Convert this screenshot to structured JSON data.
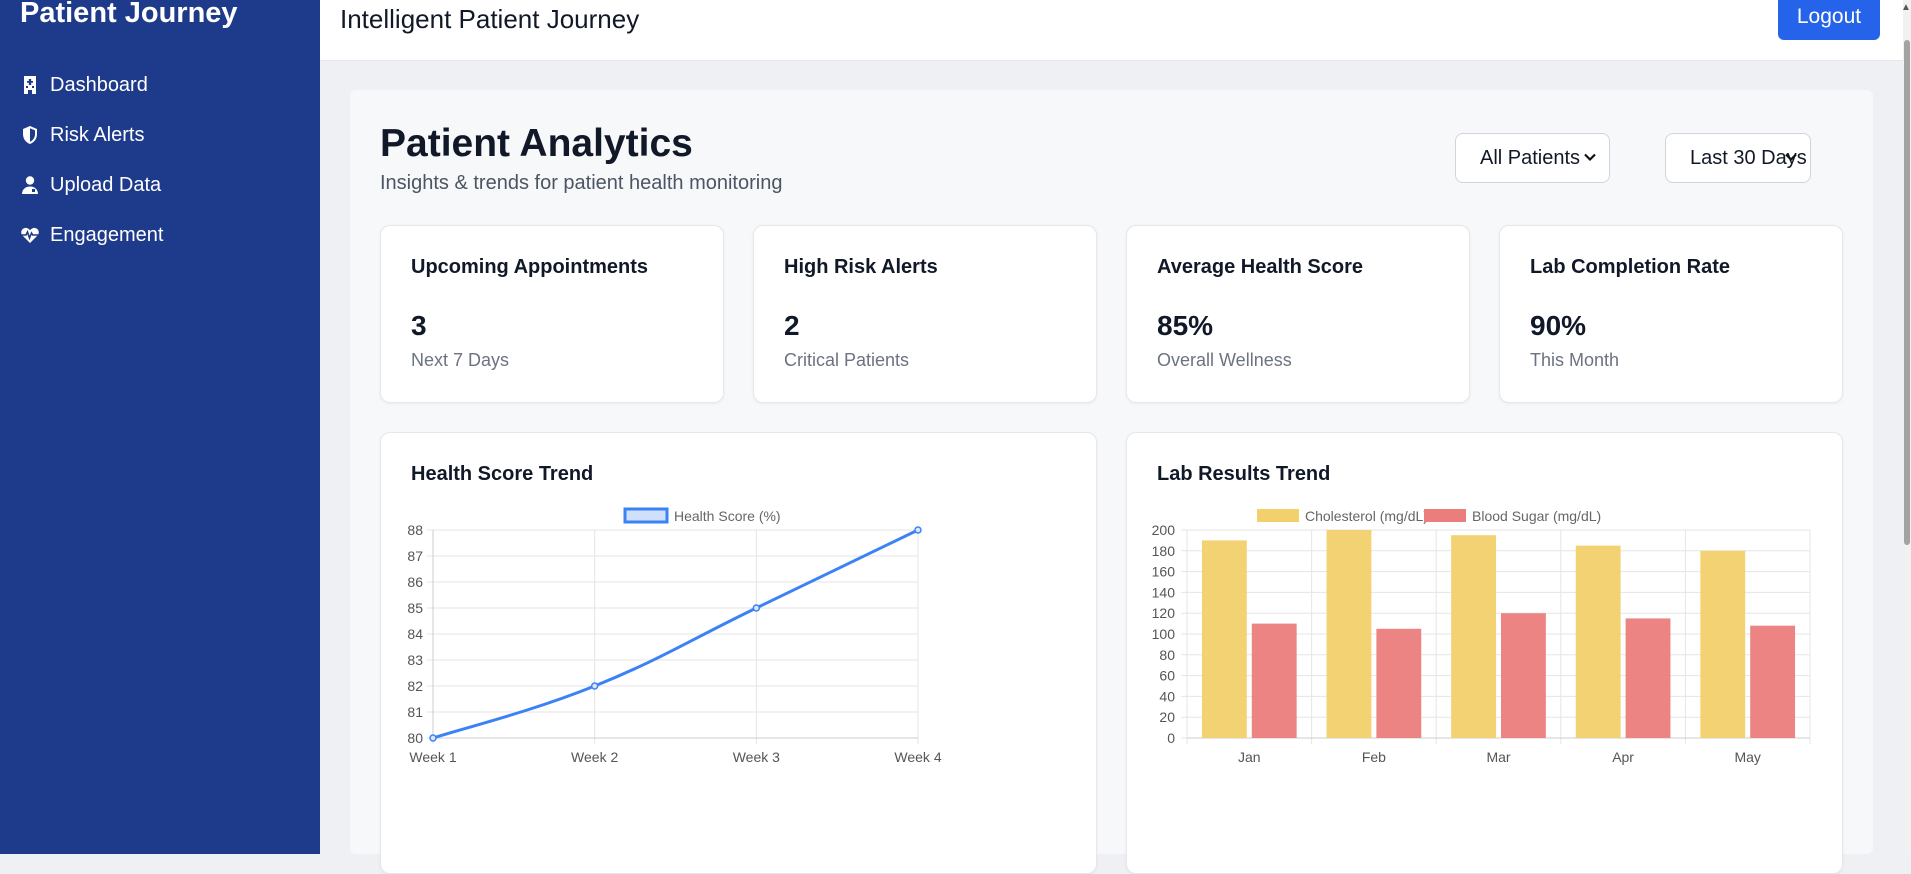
{
  "sidebar": {
    "brand": "Patient Journey",
    "items": [
      {
        "label": "Dashboard",
        "icon": "hospital-icon"
      },
      {
        "label": "Risk Alerts",
        "icon": "shield-icon"
      },
      {
        "label": "Upload Data",
        "icon": "user-doctor-icon"
      },
      {
        "label": "Engagement",
        "icon": "heart-pulse-icon"
      }
    ]
  },
  "header": {
    "title": "Intelligent Patient Journey",
    "logout_label": "Logout"
  },
  "main": {
    "title": "Patient Analytics",
    "subtitle": "Insights & trends for patient health monitoring",
    "filters": {
      "patients": {
        "selected": "All Patients"
      },
      "range": {
        "selected": "Last 30 Days"
      }
    },
    "stats": [
      {
        "title": "Upcoming Appointments",
        "value": "3",
        "sub": "Next 7 Days"
      },
      {
        "title": "High Risk Alerts",
        "value": "2",
        "sub": "Critical Patients"
      },
      {
        "title": "Average Health Score",
        "value": "85%",
        "sub": "Overall Wellness"
      },
      {
        "title": "Lab Completion Rate",
        "value": "90%",
        "sub": "This Month"
      }
    ],
    "charts": [
      {
        "title": "Health Score Trend"
      },
      {
        "title": "Lab Results Trend"
      }
    ]
  },
  "colors": {
    "sidebar_bg": "#1e3a8a",
    "primary": "#2563eb",
    "line": "#3b82f6",
    "cholesterol": "#f2d06b",
    "blood_sugar": "#eb7d7d"
  },
  "chart_data": [
    {
      "type": "line",
      "title": "Health Score Trend",
      "categories": [
        "Week 1",
        "Week 2",
        "Week 3",
        "Week 4"
      ],
      "series": [
        {
          "name": "Health Score (%)",
          "values": [
            80,
            82,
            85,
            88
          ]
        }
      ],
      "ylim": [
        80,
        88
      ],
      "yticks": [
        80,
        81,
        82,
        83,
        84,
        85,
        86,
        87,
        88
      ],
      "grid": true,
      "legend": "top"
    },
    {
      "type": "bar",
      "title": "Lab Results Trend",
      "categories": [
        "Jan",
        "Feb",
        "Mar",
        "Apr",
        "May"
      ],
      "series": [
        {
          "name": "Cholesterol (mg/dL)",
          "values": [
            190,
            200,
            195,
            185,
            180
          ]
        },
        {
          "name": "Blood Sugar (mg/dL)",
          "values": [
            110,
            105,
            120,
            115,
            108
          ]
        }
      ],
      "ylim": [
        0,
        200
      ],
      "yticks": [
        0,
        20,
        40,
        60,
        80,
        100,
        120,
        140,
        160,
        180,
        200
      ],
      "grid": true,
      "legend": "top"
    }
  ]
}
